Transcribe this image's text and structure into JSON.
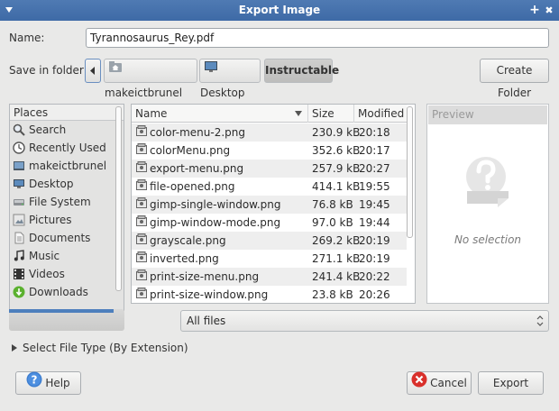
{
  "window": {
    "title": "Export Image",
    "pin_symbol": "+",
    "close_symbol": "✖"
  },
  "name": {
    "label": "Name:",
    "value": "Tyrannosaurus_Rey.pdf"
  },
  "folder": {
    "label": "Save in folder:",
    "breadcrumbs": [
      {
        "label": "makeictbrunel",
        "icon": "home-folder-icon"
      },
      {
        "label": "Desktop",
        "icon": "desktop-icon"
      },
      {
        "label": "Instructable",
        "active": true
      }
    ],
    "create_folder_label": "Create Folder"
  },
  "places": {
    "header": "Places",
    "items": [
      {
        "label": "Search",
        "icon": "search-icon"
      },
      {
        "label": "Recently Used",
        "icon": "clock-icon"
      },
      {
        "label": "makeictbrunel",
        "icon": "home-icon"
      },
      {
        "label": "Desktop",
        "icon": "desktop-icon"
      },
      {
        "label": "File System",
        "icon": "drive-icon"
      },
      {
        "label": "Pictures",
        "icon": "pictures-icon"
      },
      {
        "label": "Documents",
        "icon": "documents-icon"
      },
      {
        "label": "Music",
        "icon": "music-icon"
      },
      {
        "label": "Videos",
        "icon": "videos-icon"
      },
      {
        "label": "Downloads",
        "icon": "downloads-icon"
      }
    ]
  },
  "files": {
    "columns": {
      "name": "Name",
      "size": "Size",
      "modified": "Modified"
    },
    "rows": [
      {
        "name": "color-menu-2.png",
        "size": "230.9 kB",
        "modified": "20:18"
      },
      {
        "name": "colorMenu.png",
        "size": "352.6 kB",
        "modified": "20:17"
      },
      {
        "name": "export-menu.png",
        "size": "257.9 kB",
        "modified": "20:27"
      },
      {
        "name": "file-opened.png",
        "size": "414.1 kB",
        "modified": "19:55"
      },
      {
        "name": "gimp-single-window.png",
        "size": "76.8 kB",
        "modified": "19:45"
      },
      {
        "name": "gimp-window-mode.png",
        "size": "97.0 kB",
        "modified": "19:44"
      },
      {
        "name": "grayscale.png",
        "size": "269.2 kB",
        "modified": "20:19"
      },
      {
        "name": "inverted.png",
        "size": "271.1 kB",
        "modified": "20:19"
      },
      {
        "name": "print-size-menu.png",
        "size": "241.4 kB",
        "modified": "20:22"
      },
      {
        "name": "print-size-window.png",
        "size": "23.8 kB",
        "modified": "20:26"
      }
    ]
  },
  "preview": {
    "header": "Preview",
    "empty_text": "No selection"
  },
  "filter": {
    "selected": "All files"
  },
  "file_type": {
    "label": "Select File Type (By Extension)"
  },
  "buttons": {
    "help": "Help",
    "cancel": "Cancel",
    "export": "Export"
  },
  "colors": {
    "titlebar": "#4474ad",
    "selection": "#4d7fbd"
  }
}
